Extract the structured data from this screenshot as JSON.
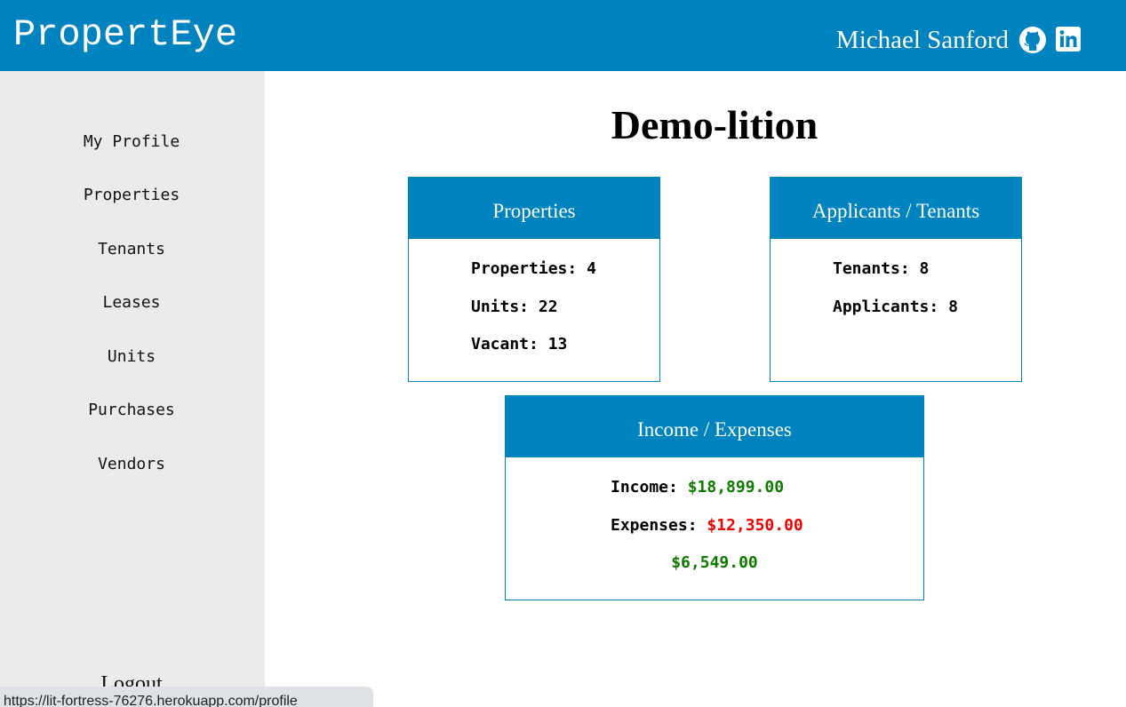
{
  "header": {
    "brand": "PropertEye",
    "user_name": "Michael Sanford"
  },
  "sidebar": {
    "items": [
      {
        "label": "My Profile"
      },
      {
        "label": "Properties"
      },
      {
        "label": "Tenants"
      },
      {
        "label": "Leases"
      },
      {
        "label": "Units"
      },
      {
        "label": "Purchases"
      },
      {
        "label": "Vendors"
      }
    ],
    "logout_label": "Logout"
  },
  "main": {
    "title": "Demo-lition",
    "cards": {
      "properties": {
        "title": "Properties",
        "stats": [
          {
            "label": "Properties:",
            "value": "4"
          },
          {
            "label": "Units:",
            "value": "22"
          },
          {
            "label": "Vacant:",
            "value": "13"
          }
        ]
      },
      "applicants": {
        "title": "Applicants / Tenants",
        "stats": [
          {
            "label": "Tenants:",
            "value": "8"
          },
          {
            "label": "Applicants:",
            "value": "8"
          }
        ]
      },
      "income": {
        "title": "Income / Expenses",
        "income_label": "Income:",
        "income_value": "$18,899.00",
        "expenses_label": "Expenses:",
        "expenses_value": "$12,350.00",
        "net_value": "$6,549.00"
      }
    }
  },
  "status_bar": {
    "url": "https://lit-fortress-76276.herokuapp.com/profile"
  },
  "colors": {
    "brand_blue": "#0083bf",
    "sidebar_bg": "#ebebeb",
    "positive": "#0f7a00",
    "negative": "#ee0000"
  },
  "icons": {
    "github": "github-icon",
    "linkedin": "linkedin-icon"
  }
}
